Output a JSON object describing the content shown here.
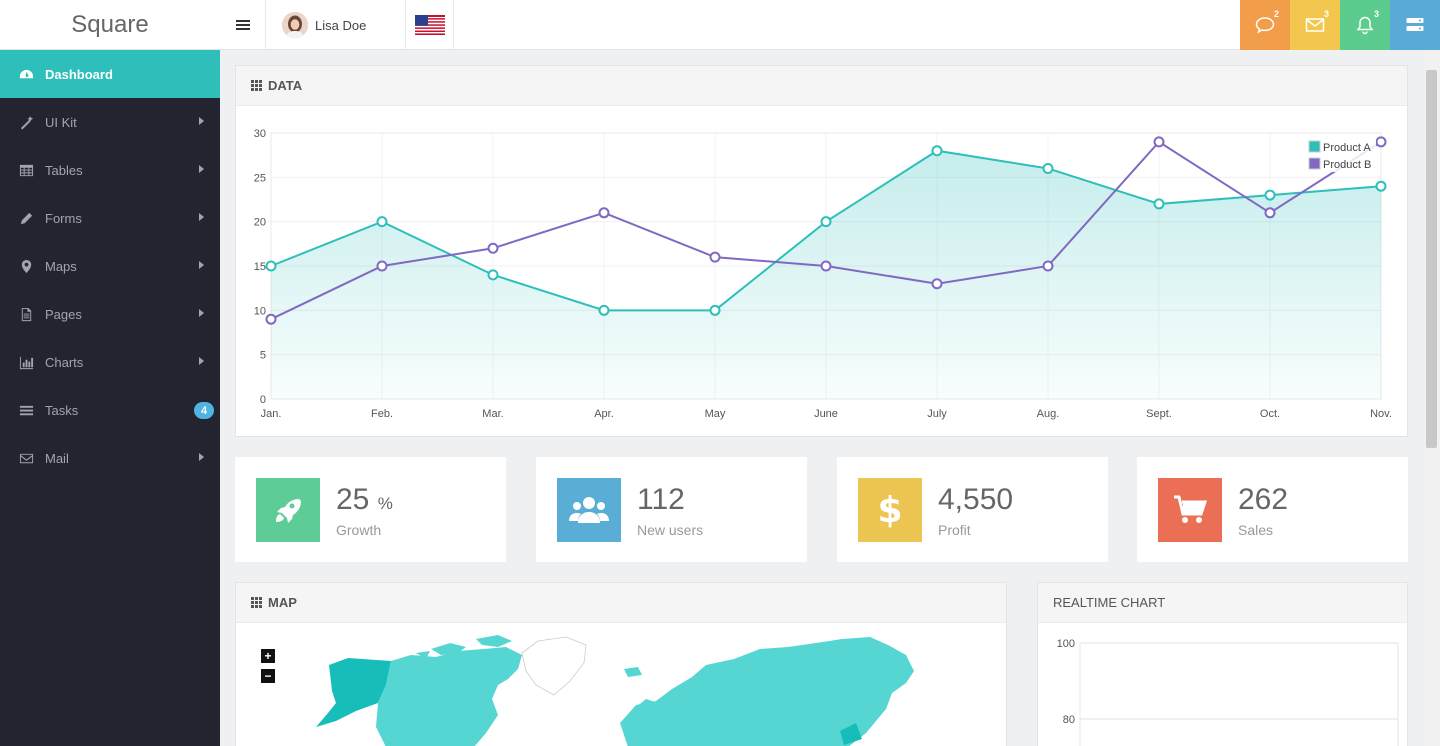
{
  "brand": "Square",
  "user": {
    "name": "Lisa Doe"
  },
  "topbar": {
    "messages_count": "2",
    "mail_count": "3",
    "notifications_count": "3",
    "colors": {
      "messages": "#f29d4a",
      "mail": "#f3c74e",
      "notifications": "#5bcc8e",
      "settings": "#5aaad8"
    }
  },
  "sidebar": {
    "items": [
      {
        "label": "Dashboard",
        "icon": "dashboard-icon"
      },
      {
        "label": "UI Kit",
        "icon": "magic-wand-icon"
      },
      {
        "label": "Tables",
        "icon": "table-icon"
      },
      {
        "label": "Forms",
        "icon": "pencil-icon"
      },
      {
        "label": "Maps",
        "icon": "map-marker-icon"
      },
      {
        "label": "Pages",
        "icon": "file-icon"
      },
      {
        "label": "Charts",
        "icon": "bar-chart-icon"
      },
      {
        "label": "Tasks",
        "icon": "tasks-icon",
        "badge": "4"
      },
      {
        "label": "Mail",
        "icon": "envelope-icon"
      }
    ]
  },
  "data_panel": {
    "title": "DATA"
  },
  "stats": [
    {
      "value": "25",
      "unit": "%",
      "label": "Growth",
      "icon": "rocket-icon",
      "color": "#5ecc97"
    },
    {
      "value": "112",
      "unit": "",
      "label": "New users",
      "icon": "users-icon",
      "color": "#5aaed6"
    },
    {
      "value": "4,550",
      "unit": "",
      "label": "Profit",
      "icon": "dollar-icon",
      "color": "#ecc553"
    },
    {
      "value": "262",
      "unit": "",
      "label": "Sales",
      "icon": "cart-icon",
      "color": "#ea6f54"
    }
  ],
  "map_panel": {
    "title": "MAP",
    "zoom_in": "+",
    "zoom_out": "−"
  },
  "realtime_panel": {
    "title": "REALTIME CHART"
  },
  "chart_data": [
    {
      "type": "line",
      "categories": [
        "Jan.",
        "Feb.",
        "Mar.",
        "Apr.",
        "May",
        "June",
        "July",
        "Aug.",
        "Sept.",
        "Oct.",
        "Nov."
      ],
      "series": [
        {
          "name": "Product A",
          "values": [
            15,
            20,
            14,
            10,
            10,
            20,
            28,
            26,
            22,
            23,
            24
          ],
          "color": "#2ebfbb",
          "fill": true
        },
        {
          "name": "Product B",
          "values": [
            9,
            15,
            17,
            21,
            16,
            15,
            13,
            15,
            29,
            21,
            29
          ],
          "color": "#8068c3",
          "fill": false
        }
      ],
      "ylim": [
        0,
        30
      ],
      "yticks": [
        0,
        5,
        10,
        15,
        20,
        25,
        30
      ],
      "grid": true,
      "legend": "top-right"
    },
    {
      "type": "line",
      "yticks": [
        80,
        100
      ],
      "series": []
    }
  ]
}
